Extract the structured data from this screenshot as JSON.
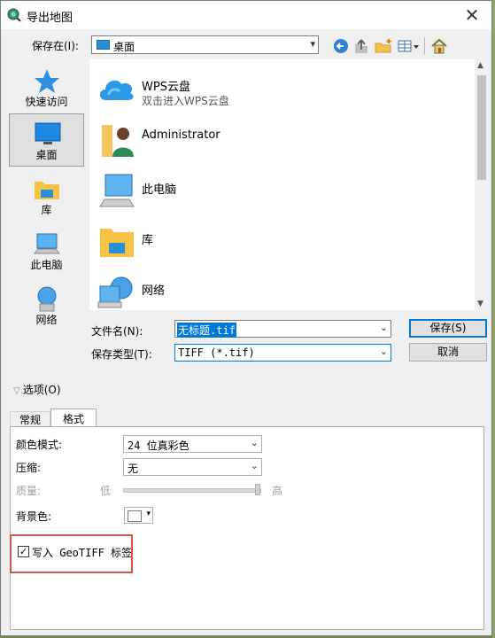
{
  "window": {
    "title": "导出地图",
    "close_glyph": "✕"
  },
  "save_in": {
    "label": "保存在(I):",
    "value": "桌面"
  },
  "places": [
    {
      "label": "快速访问",
      "icon": "star-icon"
    },
    {
      "label": "桌面",
      "icon": "desktop-icon",
      "selected": true
    },
    {
      "label": "库",
      "icon": "library-folder-icon"
    },
    {
      "label": "此电脑",
      "icon": "computer-icon"
    },
    {
      "label": "网络",
      "icon": "network-icon"
    }
  ],
  "files": [
    {
      "name": "WPS云盘",
      "sub": "双击进入WPS云盘",
      "icon": "cloud-icon"
    },
    {
      "name": "Administrator",
      "sub": "",
      "icon": "user-folder-icon"
    },
    {
      "name": "此电脑",
      "sub": "",
      "icon": "computer-icon"
    },
    {
      "name": "库",
      "sub": "",
      "icon": "library-folder-icon"
    },
    {
      "name": "网络",
      "sub": "",
      "icon": "network-icon"
    }
  ],
  "filename": {
    "label": "文件名(N):",
    "value": "无标题.tif"
  },
  "filetype": {
    "label": "保存类型(T):",
    "value": "TIFF (*.tif)"
  },
  "buttons": {
    "save": "保存(S)",
    "cancel": "取消"
  },
  "options": {
    "label": "选项(O)"
  },
  "tabs": [
    {
      "label": "常规",
      "active": false
    },
    {
      "label": "格式",
      "active": true
    }
  ],
  "format": {
    "color_mode": {
      "label": "颜色模式:",
      "value": "24 位真彩色"
    },
    "compression": {
      "label": "压缩:",
      "value": "无"
    },
    "quality": {
      "label": "质量:",
      "low": "低",
      "high": "高",
      "value": 1.0,
      "enabled": false
    },
    "background": {
      "label": "背景色:",
      "color": "#ffffff"
    },
    "geotiff": {
      "label": "写入 GeoTIFF 标签",
      "checked": true
    }
  },
  "colors": {
    "accent": "#0078d7",
    "highlight_box": "#e0504c"
  }
}
